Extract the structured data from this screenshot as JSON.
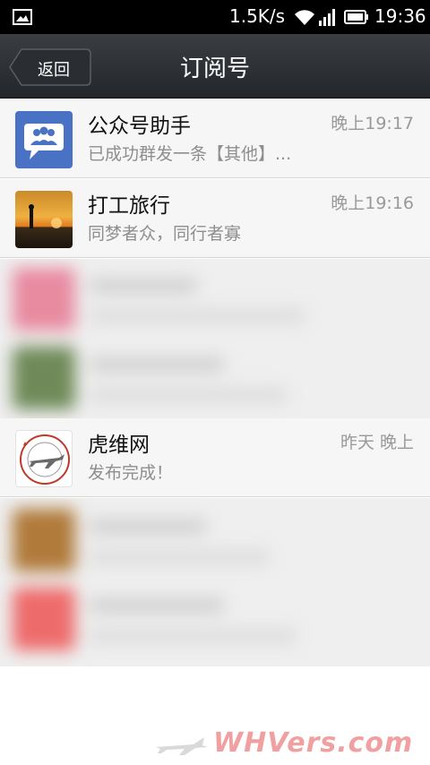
{
  "status_bar": {
    "network_speed": "1.5K/s",
    "time": "19:36",
    "icons": [
      "picture-icon",
      "wifi-icon",
      "signal-icon",
      "battery-icon"
    ]
  },
  "header": {
    "back_label": "返回",
    "title": "订阅号"
  },
  "rows": [
    {
      "name": "公众号助手",
      "time": "晚上19:17",
      "preview": "已成功群发一条【其他】..."
    },
    {
      "name": "打工旅行",
      "time": "晚上19:16",
      "preview": "同梦者众，同行者寡"
    },
    {
      "name": "虎维网",
      "time": "昨天 晚上",
      "preview": "发布完成！"
    }
  ],
  "watermark": {
    "text": "WHVers.com"
  },
  "colors": {
    "title_bar": "#2b2e32",
    "row_bg": "#f6f6f6",
    "watermark": "#f0a0a0"
  }
}
